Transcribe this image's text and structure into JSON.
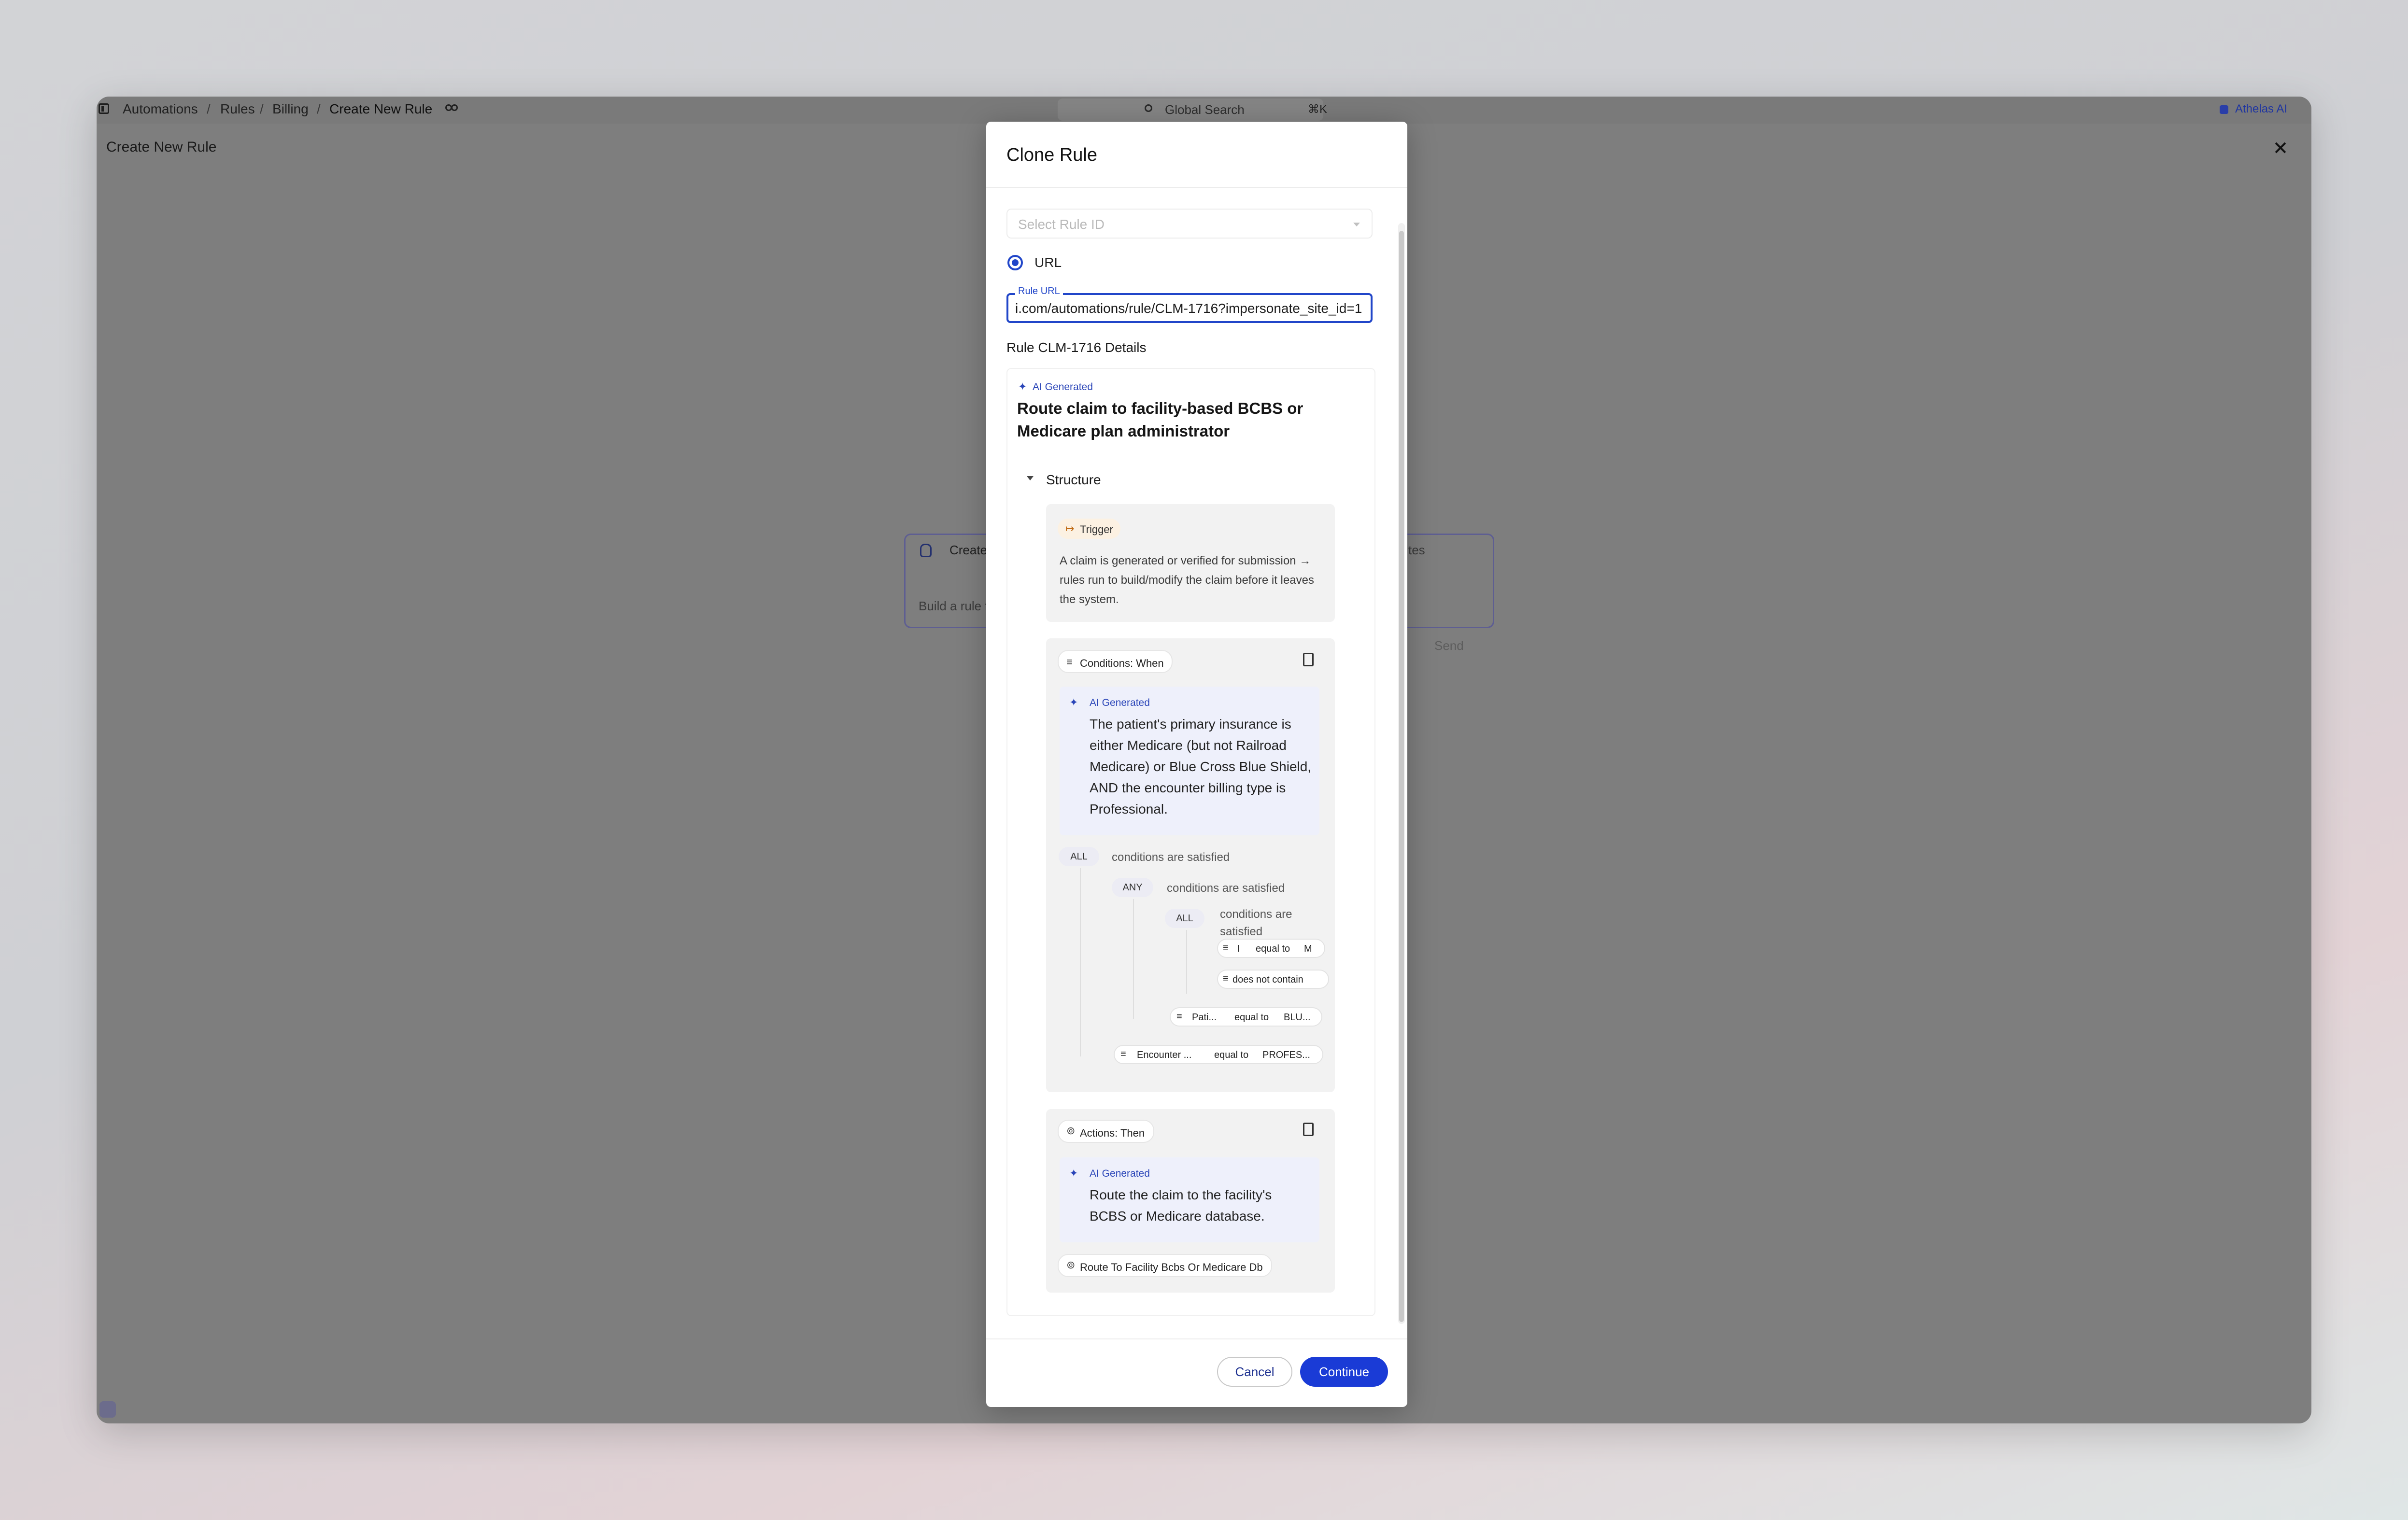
{
  "topbar": {
    "breadcrumbs": [
      "Automations",
      "Rules",
      "Billing",
      "Create New Rule"
    ],
    "search_placeholder": "Global Search",
    "search_shortcut": "⌘K",
    "assistant_label": "Athelas AI"
  },
  "page": {
    "title": "Create New Rule",
    "background_tab_label": "Create",
    "background_tab_right": "tes",
    "background_input_placeholder": "Build a rule t",
    "background_send": "Send"
  },
  "modal": {
    "title": "Clone Rule",
    "select_placeholder": "Select Rule ID",
    "radio_label": "URL",
    "url_label": "Rule URL",
    "url_value": "i.com/automations/rule/CLM-1716?impersonate_site_id=1",
    "details_heading": "Rule CLM-1716 Details",
    "ai_generated": "AI Generated",
    "rule_title": "Route claim to facility-based BCBS or Medicare plan administrator",
    "structure_label": "Structure",
    "trigger": {
      "label": "Trigger",
      "description": "A claim is generated or verified for submission → rules run to build/modify the claim before it leaves the system."
    },
    "conditions": {
      "label": "Conditions: When",
      "ai_generated": "AI Generated",
      "summary": "The patient's primary insurance is either Medicare (but not Railroad Medicare) or Blue Cross Blue Shield, AND the encounter billing type is Professional.",
      "root": {
        "gate": "ALL",
        "text": "conditions are satisfied"
      },
      "any": {
        "gate": "ANY",
        "text": "conditions are satisfied"
      },
      "inner_all": {
        "gate": "ALL",
        "text": "conditions are satisfied"
      },
      "leaf1": {
        "field": "I",
        "op": "equal to",
        "value": "M"
      },
      "leaf2": {
        "op": "does not contain"
      },
      "leaf3": {
        "field": "Pati...",
        "op": "equal to",
        "value": "BLU..."
      },
      "leaf4": {
        "field": "Encounter ...",
        "op": "equal to",
        "value": "PROFES..."
      }
    },
    "actions": {
      "label": "Actions: Then",
      "ai_generated": "AI Generated",
      "summary": "Route the claim to the facility's BCBS or Medicare database.",
      "action_chip": "Route To Facility Bcbs Or Medicare Db"
    },
    "cancel_label": "Cancel",
    "continue_label": "Continue"
  },
  "colors": {
    "accent": "#1a3bd6",
    "ai_tag": "#2a45b8",
    "trigger_chip_bg": "#fcf1e2",
    "ai_box_bg": "#eef0fb"
  }
}
